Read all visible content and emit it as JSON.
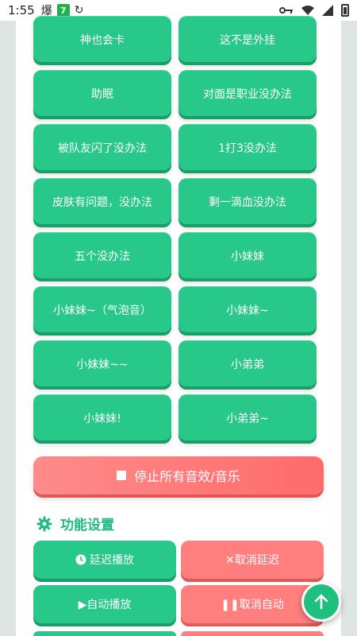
{
  "status_bar": {
    "time": "1:55",
    "notification_glyph": "爆",
    "badge": "7"
  },
  "sound_buttons": [
    "神也会卡",
    "这不是外挂",
    "助眠",
    "对面是职业没办法",
    "被队友闪了没办法",
    "1打3没办法",
    "皮肤有问题，没办法",
    "剩一滴血没办法",
    "五个没办法",
    "小妹妹",
    "小妹妹~（气泡音）",
    "小妹妹~",
    "小妹妹~~",
    "小弟弟",
    "小妹妹!",
    "小弟弟~"
  ],
  "stop_button": {
    "label": "停止所有音效/音乐"
  },
  "settings": {
    "title": "功能设置",
    "delay_play": "延迟播放",
    "cancel_delay": "✕取消延迟",
    "auto_play": "▶自动播放",
    "cancel_auto": "❚❚取消自动"
  },
  "colors": {
    "primary_green": "#27c88a",
    "stop_red": "#ff6b6b",
    "accent": "#1fba82"
  },
  "icons": [
    "signal-icon",
    "wifi-icon",
    "battery-icon",
    "gear-icon",
    "clock-icon",
    "arrow-up-icon"
  ]
}
